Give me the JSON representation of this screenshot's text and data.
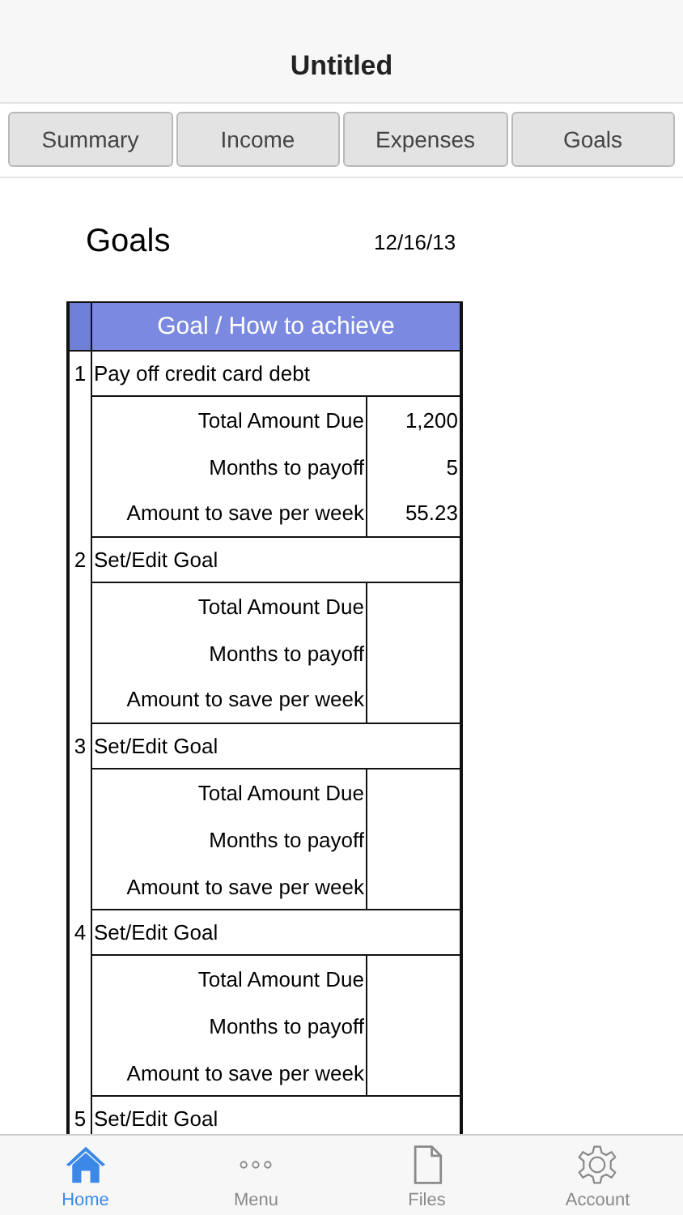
{
  "navigation_bar": {
    "title": "Untitled"
  },
  "segments": [
    {
      "label": "Summary"
    },
    {
      "label": "Income"
    },
    {
      "label": "Expenses"
    },
    {
      "label": "Goals"
    }
  ],
  "page": {
    "title": "Goals",
    "date": "12/16/13"
  },
  "table": {
    "header": "Goal / How to achieve",
    "goals": [
      {
        "number": "1",
        "title": "Pay off credit card debt",
        "details": [
          {
            "label": "Total Amount Due",
            "value": "1,200"
          },
          {
            "label": "Months to payoff",
            "value": "5"
          },
          {
            "label": "Amount to save per week",
            "value": "55.23"
          }
        ]
      },
      {
        "number": "2",
        "title": "Set/Edit Goal",
        "details": [
          {
            "label": "Total Amount Due"
          },
          {
            "label": "Months to payoff"
          },
          {
            "label": "Amount to save per week"
          }
        ]
      },
      {
        "number": "3",
        "title": "Set/Edit Goal",
        "details": [
          {
            "label": "Total Amount Due"
          },
          {
            "label": "Months to payoff"
          },
          {
            "label": "Amount to save per week"
          }
        ]
      },
      {
        "number": "4",
        "title": "Set/Edit Goal",
        "details": [
          {
            "label": "Total Amount Due"
          },
          {
            "label": "Months to payoff"
          },
          {
            "label": "Amount to save per week"
          }
        ]
      },
      {
        "number": "5",
        "title": "Set/Edit Goal"
      }
    ]
  },
  "tab_bar": [
    {
      "label": "Home",
      "kind": "home",
      "selected": true
    },
    {
      "label": "Menu",
      "kind": "menu",
      "selected": false
    },
    {
      "label": "Files",
      "kind": "files",
      "selected": false
    },
    {
      "label": "Account",
      "kind": "account",
      "selected": false
    }
  ]
}
